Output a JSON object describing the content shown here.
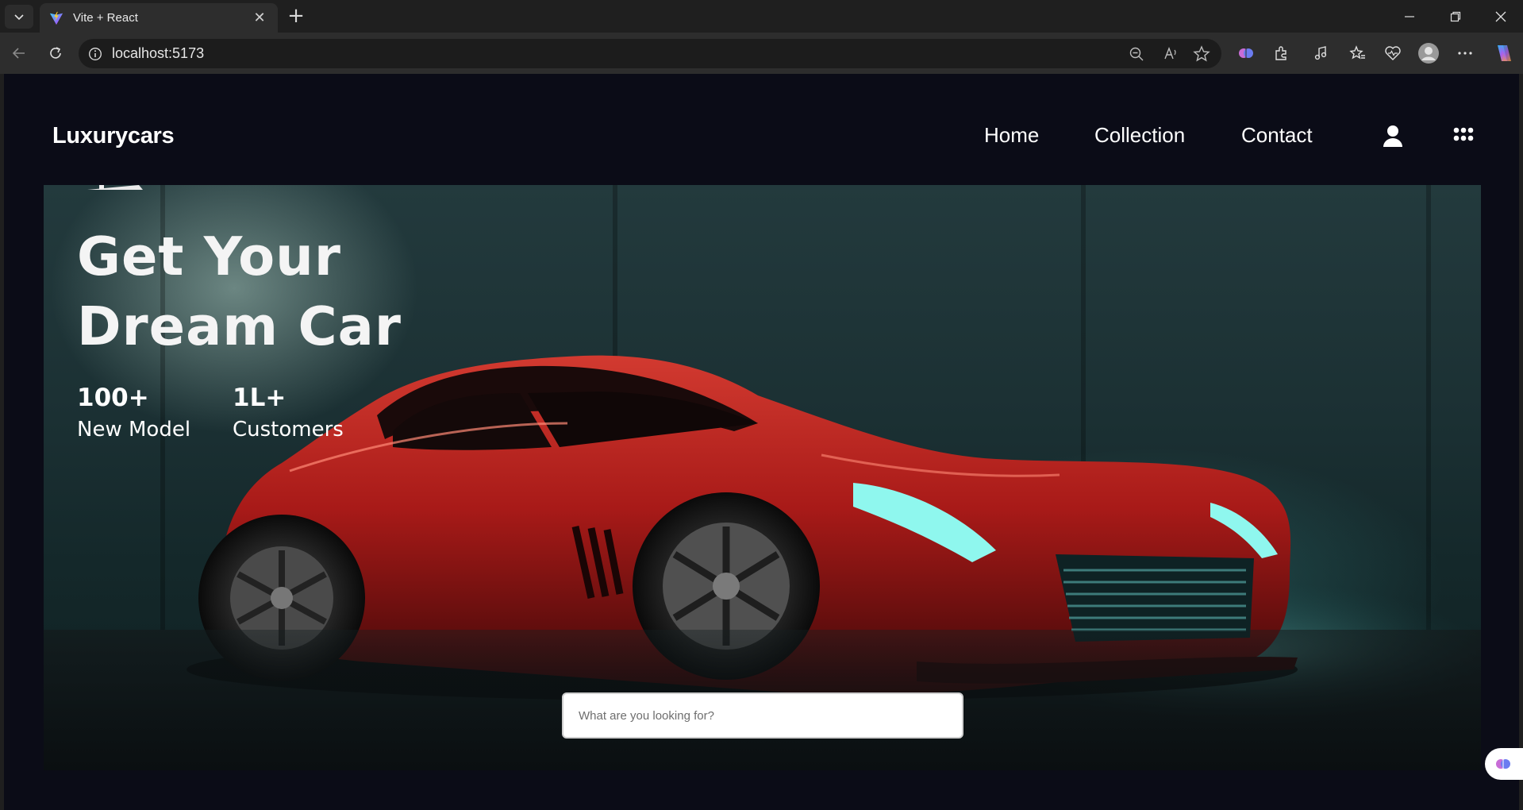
{
  "browser": {
    "tab_title": "Vite + React",
    "address_url": "localhost:5173"
  },
  "site": {
    "brand": "Luxurycars",
    "nav": [
      "Home",
      "Collection",
      "Contact"
    ]
  },
  "hero": {
    "title": "Get Your Dream Car",
    "stats": [
      {
        "value": "100+",
        "label": "New Model"
      },
      {
        "value": "1L+",
        "label": "Customers"
      }
    ]
  },
  "search": {
    "placeholder": "What are you looking for?"
  },
  "colors": {
    "page_bg": "#0b0c17",
    "car_red": "#b01818",
    "headlight_teal": "#5ef0e0"
  }
}
